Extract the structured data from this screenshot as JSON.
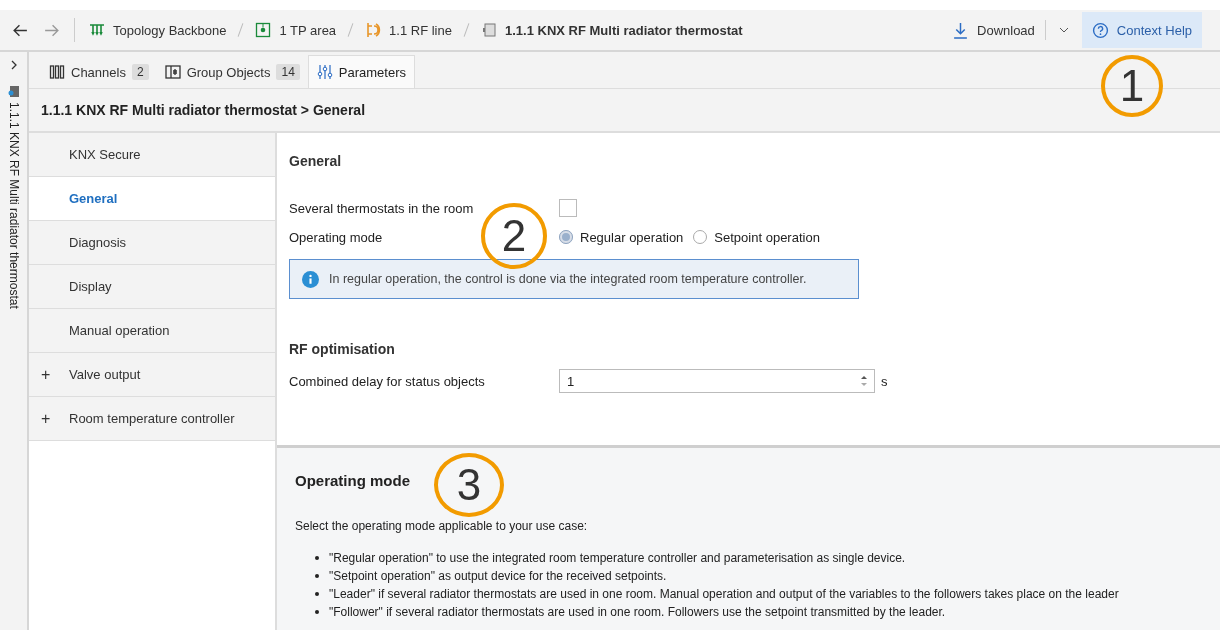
{
  "toolbar": {
    "breadcrumbs": [
      {
        "kind": "topology",
        "label": "Topology Backbone"
      },
      {
        "kind": "area",
        "label": "1 TP area"
      },
      {
        "kind": "line",
        "label": "1.1 RF line"
      },
      {
        "kind": "device",
        "label": "1.1.1 KNX RF Multi radiator thermostat"
      }
    ],
    "download": "Download",
    "context_help": {
      "label": "Context Help",
      "selected": true
    }
  },
  "side_strip": {
    "label": "1.1.1 KNX RF Multi radiator thermostat"
  },
  "tabs": [
    {
      "kind": "channels",
      "label": "Channels",
      "count": "2",
      "selected": false
    },
    {
      "kind": "objects",
      "label": "Group Objects",
      "count": "14",
      "selected": false
    },
    {
      "kind": "parameters",
      "label": "Parameters",
      "selected": true
    }
  ],
  "path_title": "1.1.1 KNX RF Multi radiator thermostat > General",
  "sidebar": {
    "items": [
      {
        "label": "KNX Secure",
        "selected": false
      },
      {
        "label": "General",
        "selected": true
      },
      {
        "label": "Diagnosis",
        "selected": false
      },
      {
        "label": "Display",
        "selected": false
      },
      {
        "label": "Manual operation",
        "selected": false
      },
      {
        "label": "Valve output",
        "selected": false,
        "expander": "+"
      },
      {
        "label": "Room temperature controller",
        "selected": false,
        "expander": "+"
      }
    ]
  },
  "general": {
    "heading": "General",
    "several_thermostats": {
      "label": "Several thermostats in the room",
      "checked": false
    },
    "operating_mode": {
      "label": "Operating mode",
      "options": [
        {
          "label": "Regular operation",
          "selected": true
        },
        {
          "label": "Setpoint operation",
          "selected": false
        }
      ]
    },
    "info": "In regular operation, the control is done via the integrated room temperature controller."
  },
  "rf_optimisation": {
    "heading": "RF optimisation",
    "delay": {
      "label": "Combined delay for status objects",
      "value": "1",
      "unit": "s"
    }
  },
  "help": {
    "heading": "Operating mode",
    "intro": "Select the operating mode applicable to your use case:",
    "bullets": [
      "\"Regular operation\" to use the integrated room temperature controller and parameterisation as single device.",
      "\"Setpoint operation\" as output device for the received setpoints.",
      "\"Leader\" if several radiator thermostats are used in one room. Manual operation and output of the variables to the followers takes place on the leader",
      "\"Follower\" if several radiator thermostats are used in one room. Followers use the setpoint transmitted by the leader."
    ]
  },
  "callouts": [
    "1",
    "2",
    "3"
  ]
}
